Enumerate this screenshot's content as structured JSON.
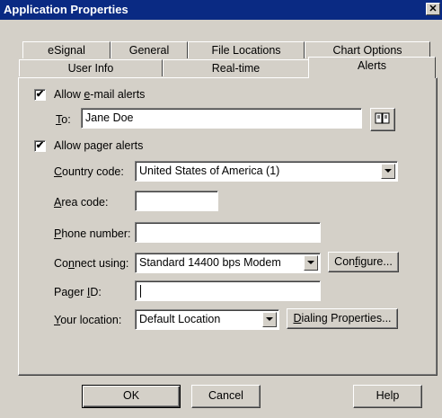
{
  "window": {
    "title": "Application Properties",
    "close_glyph": "✕"
  },
  "tabs": {
    "row1": [
      "eSignal",
      "General",
      "File Locations",
      "Chart Options"
    ],
    "row2": [
      "User Info",
      "Real-time",
      "Alerts"
    ],
    "selected": "Alerts"
  },
  "email": {
    "checkbox_label_pre": "Allow ",
    "checkbox_label_ul": "e",
    "checkbox_label_post": "-mail alerts",
    "checked": true,
    "to_label_ul": "T",
    "to_label_post": "o:",
    "to_value": "Jane Doe",
    "address_book_icon": "address-book-icon"
  },
  "pager": {
    "checkbox_label": "Allow pager alerts",
    "checked": true,
    "country_label_ul": "C",
    "country_label_post": "ountry code:",
    "country_value": "United States of America (1)",
    "area_label_ul": "A",
    "area_label_post": "rea code:",
    "area_value": "",
    "phone_label_ul": "P",
    "phone_label_post": "hone number:",
    "phone_value": "",
    "connect_label_pre": "Co",
    "connect_label_ul": "n",
    "connect_label_post": "nect using:",
    "connect_value": "Standard 14400 bps Modem",
    "configure_pre": "Con",
    "configure_ul": "f",
    "configure_post": "igure...",
    "pager_id_label_pre": "Pager ",
    "pager_id_label_ul": "I",
    "pager_id_label_post": "D:",
    "pager_id_value": "",
    "location_label_ul": "Y",
    "location_label_post": "our location:",
    "location_value": "Default Location",
    "dialing_ul": "D",
    "dialing_post": "ialing Properties..."
  },
  "footer": {
    "ok": "OK",
    "cancel": "Cancel",
    "help": "Help"
  },
  "colors": {
    "titlebar": "#0a2a83",
    "face": "#d4d0c8"
  }
}
